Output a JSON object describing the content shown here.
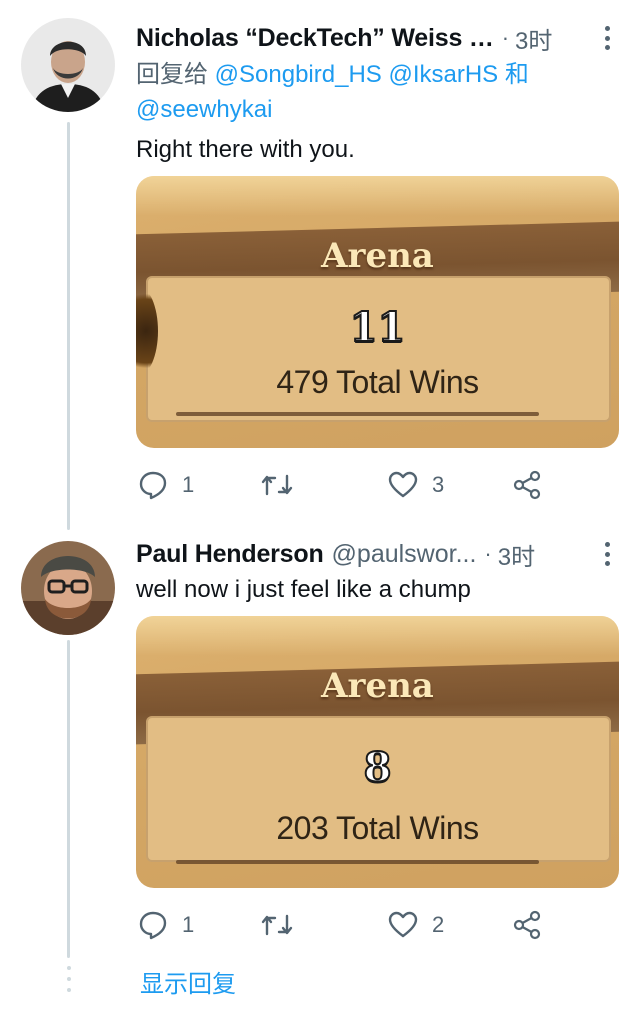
{
  "tweets": [
    {
      "display_name": "Nicholas “DeckTech” Weiss …",
      "handle": "",
      "time": "3时",
      "reply_prefix": "回复给",
      "reply_mentions": [
        "@Songbird_HS",
        "@IksarHS"
      ],
      "reply_joiner": "和",
      "reply_last_mention": "@seewhykai",
      "text": "Right there with you.",
      "media": {
        "title": "Arena",
        "wins": "11",
        "total": "479 Total Wins"
      },
      "reply_count": "1",
      "retweet_count": "",
      "like_count": "3"
    },
    {
      "display_name": "Paul Henderson",
      "handle": "@paulswor...",
      "time": "3时",
      "text": "well now i just feel like a chump",
      "media": {
        "title": "Arena",
        "wins": "8",
        "total": "203 Total Wins"
      },
      "reply_count": "1",
      "retweet_count": "",
      "like_count": "2"
    }
  ],
  "show_replies_label": "显示回复",
  "icons": {
    "reply": "reply-icon",
    "retweet": "retweet-icon",
    "like": "heart-icon",
    "share": "share-icon",
    "more": "more-vertical-icon"
  },
  "colors": {
    "link": "#1d9bf0",
    "secondary_text": "#536471",
    "thread_line": "#cfd9de"
  }
}
